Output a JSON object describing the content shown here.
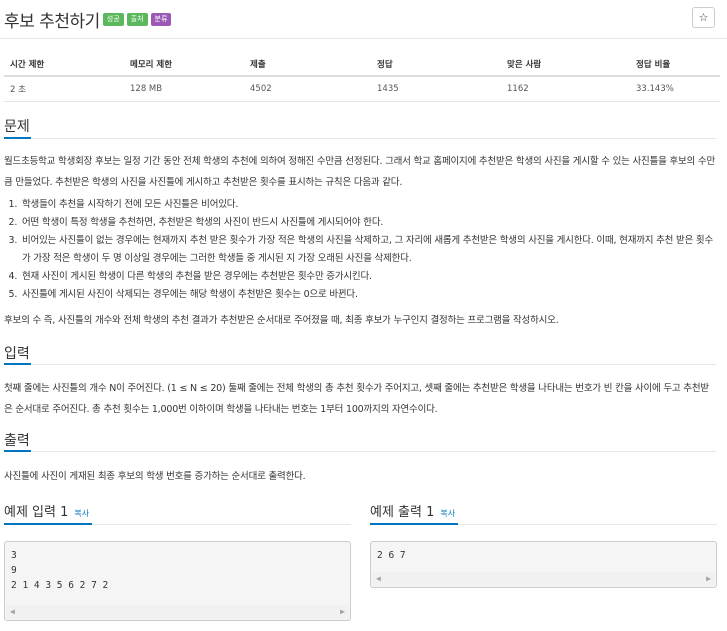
{
  "problem": {
    "title": "후보 추천하기",
    "labels": [
      {
        "text": "성공",
        "color": "#5cb85c"
      },
      {
        "text": "출처",
        "color": "#5cb85c"
      },
      {
        "text": "분류",
        "color": "#9b59b6"
      }
    ],
    "star_icon": "star-icon"
  },
  "stats": {
    "headers": [
      "시간 제한",
      "메모리 제한",
      "제출",
      "정답",
      "맞은 사람",
      "정답 비율"
    ],
    "values": [
      "2 초",
      "128 MB",
      "4502",
      "1435",
      "1162",
      "33.143%"
    ]
  },
  "sections": {
    "problem_heading": "문제",
    "problem_intro": "월드초등학교 학생회장 후보는 일정 기간 동안 전체 학생의 추천에 의하여 정해진 수만큼 선정된다. 그래서 학교 홈페이지에 추천받은 학생의 사진을 게시할 수 있는 사진틀을 후보의 수만큼 만들었다. 추천받은 학생의 사진을 사진틀에 게시하고 추천받은 횟수를 표시하는 규칙은 다음과 같다.",
    "rules": [
      "학생들이 추천을 시작하기 전에 모든 사진틀은 비어있다.",
      "어떤 학생이 특정 학생을 추천하면, 추천받은 학생의 사진이 반드시 사진틀에 게시되어야 한다.",
      "비어있는 사진틀이 없는 경우에는 현재까지 추천 받은 횟수가 가장 적은 학생의 사진을 삭제하고, 그 자리에 새롭게 추천받은 학생의 사진을 게시한다. 이때, 현재까지 추천 받은 횟수가 가장 적은 학생이 두 명 이상일 경우에는 그러한 학생들 중 게시된 지 가장 오래된 사진을 삭제한다.",
      "현재 사진이 게시된 학생이 다른 학생의 추천을 받은 경우에는 추천받은 횟수만 증가시킨다.",
      "사진틀에 게시된 사진이 삭제되는 경우에는 해당 학생이 추천받은 횟수는 0으로 바뀐다."
    ],
    "problem_outro": "후보의 수 즉, 사진틀의 개수와 전체 학생의 추천 결과가 추천받은 순서대로 주어졌을 때, 최종 후보가 누구인지 결정하는 프로그램을 작성하시오.",
    "input_heading": "입력",
    "input_text": "첫째 줄에는 사진틀의 개수 N이 주어진다. (1 ≤ N ≤ 20) 둘째 줄에는 전체 학생의 총 추천 횟수가 주어지고, 셋째 줄에는 추천받은 학생을 나타내는 번호가 빈 칸을 사이에 두고 추천받은 순서대로 주어진다. 총 추천 횟수는 1,000번 이하이며 학생을 나타내는 번호는 1부터 100까지의 자연수이다.",
    "output_heading": "출력",
    "output_text": "사진틀에 사진이 게재된 최종 후보의 학생 번호를 증가하는 순서대로 출력한다."
  },
  "samples": {
    "input": {
      "title": "예제 입력 1",
      "copy_label": "복사",
      "lines": [
        "3",
        "9",
        "2 1 4 3 5 6 2 7 2"
      ]
    },
    "output": {
      "title": "예제 출력 1",
      "copy_label": "복사",
      "lines": [
        "2 6 7"
      ]
    },
    "scroll_left_icon": "scroll-left-arrow-icon",
    "scroll_right_icon": "scroll-right-arrow-icon"
  }
}
